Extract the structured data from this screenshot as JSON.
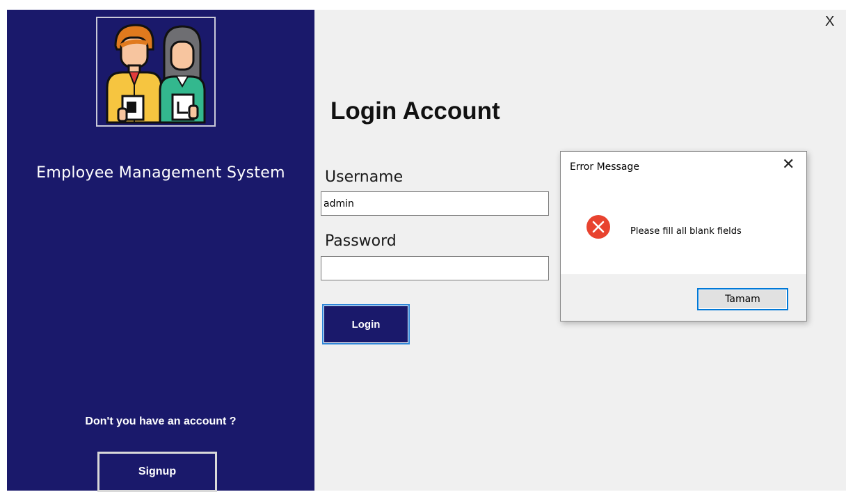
{
  "left_panel": {
    "app_title": "Employee Management System",
    "no_account_text": "Don't you have an account ?",
    "signup_label": "Signup"
  },
  "window": {
    "close_label": "X"
  },
  "login": {
    "title": "Login Account",
    "username_label": "Username",
    "username_value": "admin",
    "password_label": "Password",
    "password_value": "",
    "login_label": "Login"
  },
  "dialog": {
    "title": "Error Message",
    "close_label": "✕",
    "icon": "error-icon",
    "message": "Please fill all blank fields",
    "ok_label": "Tamam"
  },
  "colors": {
    "brand_navy": "#1a196b",
    "focus_blue": "#0078d7",
    "error_red": "#e8432f",
    "panel_gray": "#f0f0f0"
  }
}
